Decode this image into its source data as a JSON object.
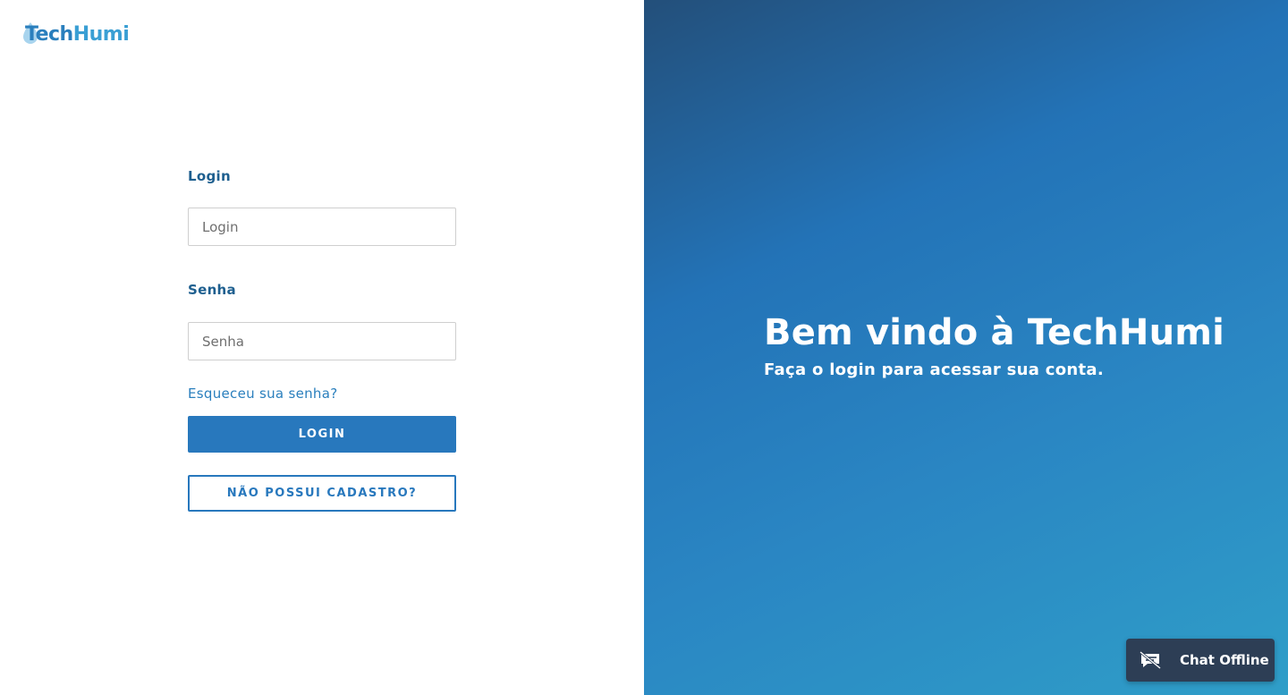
{
  "brand": {
    "part1": "Tech",
    "part2": "Humi"
  },
  "form": {
    "login_label": "Login",
    "login_placeholder": "Login",
    "login_value": "",
    "password_label": "Senha",
    "password_placeholder": "Senha",
    "password_value": "",
    "forgot_link": "Esqueceu sua senha?",
    "login_button": "LOGIN",
    "register_button": "NÃO POSSUI CADASTRO?"
  },
  "welcome": {
    "title": "Bem vindo à TechHumi",
    "subtitle": "Faça o login para acessar sua conta."
  },
  "chat": {
    "label": "Chat Offline",
    "icon": "chat-offline-icon"
  },
  "colors": {
    "primary": "#2878bd",
    "label": "#1e5f8f",
    "gradient_start": "#234f7a",
    "gradient_end": "#2f9ec8",
    "chat_bg": "#2d3e55"
  }
}
